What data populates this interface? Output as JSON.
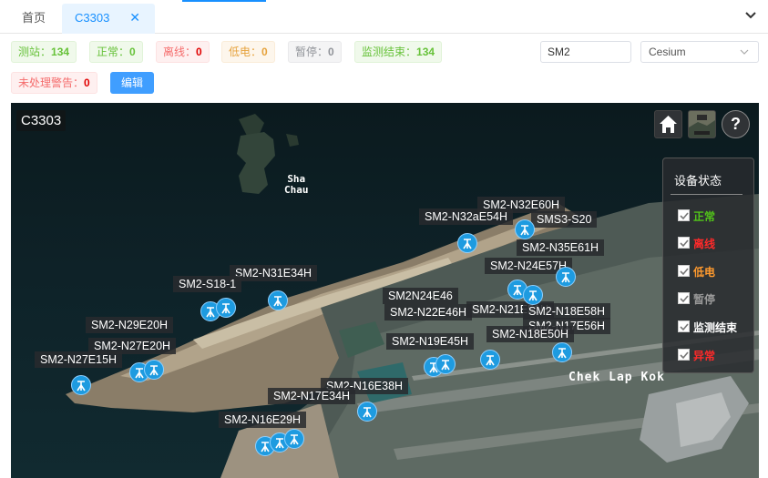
{
  "tabs": {
    "home": "首页",
    "active": "C3303"
  },
  "badges": [
    {
      "label": "测站：",
      "value": "134",
      "style": "b-green"
    },
    {
      "label": "正常：",
      "value": "0",
      "style": "b-green"
    },
    {
      "label": "离线：",
      "value": "0",
      "style": "b-red"
    },
    {
      "label": "低电：",
      "value": "0",
      "style": "b-orange"
    },
    {
      "label": "暂停：",
      "value": "0",
      "style": "b-gray"
    },
    {
      "label": "监测结束：",
      "value": "134",
      "style": "b-green"
    },
    {
      "label": "未处理警告：",
      "value": "0",
      "style": "b-red"
    }
  ],
  "toolbar": {
    "edit_label": "编辑",
    "search_value": "SM2",
    "viewer_select": "Cesium"
  },
  "map": {
    "title": "C3303",
    "places": {
      "sha_chau": "Sha\nChau",
      "chek_lap_kok": "Chek Lap Kok"
    },
    "stations": [
      "SM2-N32E60H",
      "SM2-N32aE54H",
      "SMS3-S20",
      "SM2-N35E61H",
      "SM2-N24E57H",
      "SM2-N31E34H",
      "SM2-S18-1",
      "SM2N24E46",
      "SM2-N22E46H",
      "SM2-N21E51H",
      "SM2-N18E58H",
      "SM2-N17E56H",
      "SM2-N29E20H",
      "SM2-N27E20H",
      "SM2-N27E15H",
      "SM2-N19E45H",
      "SM2-N18E50H",
      "SM2-N16E38H",
      "SM2-N17E34H",
      "SM2-N16E29H"
    ],
    "legend": {
      "title": "设备状态",
      "items": [
        {
          "label": "正常",
          "color": "#52c41a"
        },
        {
          "label": "离线",
          "color": "#ff2a2a"
        },
        {
          "label": "低电",
          "color": "#ff9a2e"
        },
        {
          "label": "暂停",
          "color": "#9a9a9a"
        },
        {
          "label": "监测结束",
          "color": "#ffffff"
        },
        {
          "label": "异常",
          "color": "#ff2a2a"
        }
      ]
    }
  }
}
